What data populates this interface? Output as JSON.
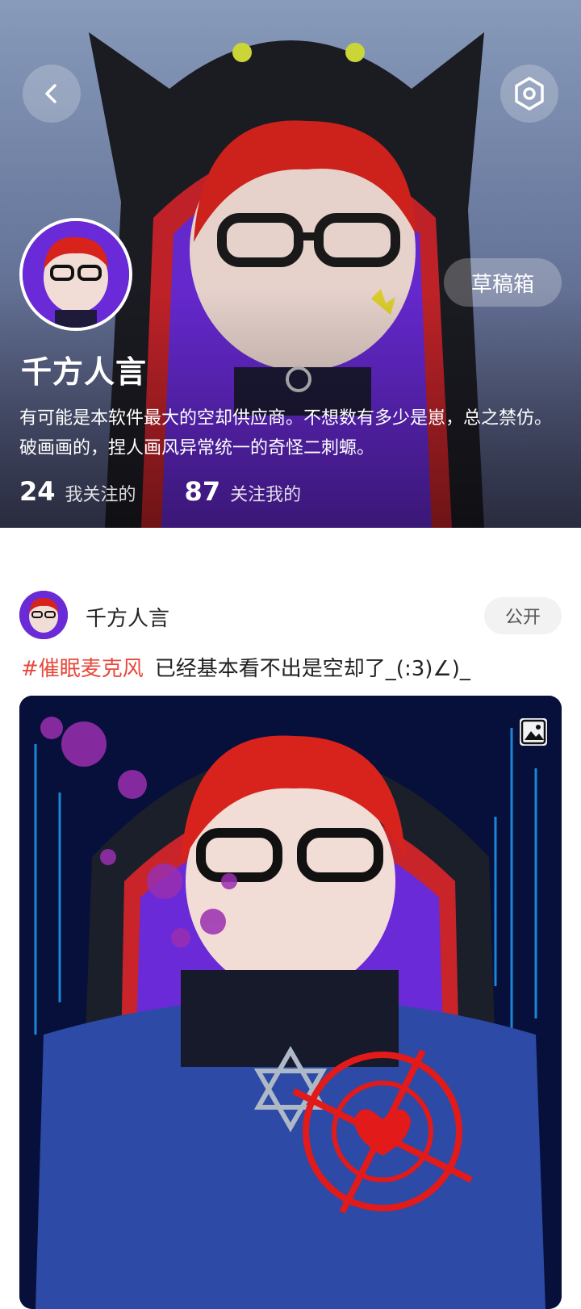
{
  "profile": {
    "nickname": "千方人言",
    "bio": "有可能是本软件最大的空却供应商。不想数有多少是崽，总之禁仿。破画画的，捏人画风异常统一的奇怪二刺螈。",
    "following_count": "24",
    "following_label": "我关注的",
    "followers_count": "87",
    "followers_label": "关注我的",
    "drafts_label": "草稿箱"
  },
  "nav": {
    "back_icon": "chevron-left-icon",
    "settings_icon": "hexagon-icon"
  },
  "post": {
    "author": "千方人言",
    "visibility": "公开",
    "hashtag": "#催眠麦克风",
    "text": "已经基本看不出是空却了_(:3)∠)_",
    "image_badge_icon": "image-icon"
  },
  "colors": {
    "hashtag": "#e8483b",
    "cover_top": "#8fa3c4",
    "cover_bottom": "#4b4f72"
  }
}
